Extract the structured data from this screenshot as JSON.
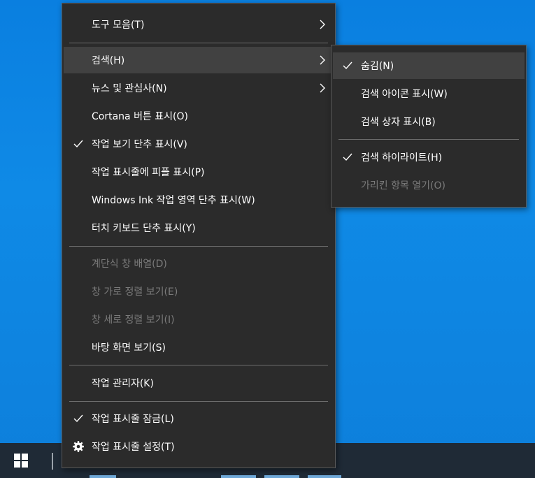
{
  "main_menu": {
    "toolbars": "도구 모음(T)",
    "search": "검색(H)",
    "news": "뉴스 및 관심사(N)",
    "cortana": "Cortana 버튼 표시(O)",
    "task_view": "작업 보기 단추 표시(V)",
    "people": "작업 표시줄에 피플 표시(P)",
    "ink": "Windows Ink 작업 영역 단추 표시(W)",
    "touch_keyboard": "터치 키보드 단추 표시(Y)",
    "cascade": "계단식 창 배열(D)",
    "stack": "창 가로 정렬 보기(E)",
    "side_by_side": "창 세로 정렬 보기(I)",
    "show_desktop": "바탕 화면 보기(S)",
    "task_manager": "작업 관리자(K)",
    "lock_taskbar": "작업 표시줄 잠금(L)",
    "taskbar_settings": "작업 표시줄 설정(T)"
  },
  "search_submenu": {
    "hidden": "숨김(N)",
    "show_icon": "검색 아이콘 표시(W)",
    "show_box": "검색 상자 표시(B)",
    "highlights": "검색 하이라이트(H)",
    "open_hidden": "가리킨 항목 열기(O)"
  },
  "colors": {
    "menu_bg": "#2b2b2b",
    "highlight": "#414141",
    "disabled_text": "#7b7b7b",
    "desktop": "#0f8ae6",
    "taskbar": "#1f2a36"
  }
}
